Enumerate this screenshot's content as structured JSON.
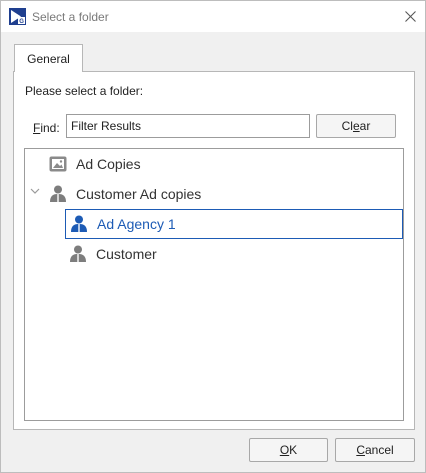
{
  "window": {
    "title": "Select a folder"
  },
  "tabs": [
    {
      "label": "General"
    }
  ],
  "form": {
    "prompt": "Please select a folder:",
    "find_mnemonic": "F",
    "find_rest": "ind:",
    "find_value": "Filter Results",
    "clear_mnemonic_pre": "Cl",
    "clear_mnemonic": "e",
    "clear_post": "ar"
  },
  "tree": {
    "items": [
      {
        "label": "Ad Copies",
        "icon": "image-folder-icon",
        "level": 0
      },
      {
        "label": "Customer Ad copies",
        "icon": "person-folder-icon",
        "level": 0,
        "expanded": true
      },
      {
        "label": "Ad Agency 1",
        "icon": "person-folder-icon",
        "level": 1,
        "selected": true
      },
      {
        "label": "Customer",
        "icon": "person-folder-icon",
        "level": 1
      }
    ]
  },
  "footer": {
    "ok_mnemonic": "O",
    "ok_rest": "K",
    "cancel_mnemonic": "C",
    "cancel_rest": "ancel"
  },
  "colors": {
    "accent": "#1d5bb5",
    "icon_gray": "#7d7d7d"
  }
}
